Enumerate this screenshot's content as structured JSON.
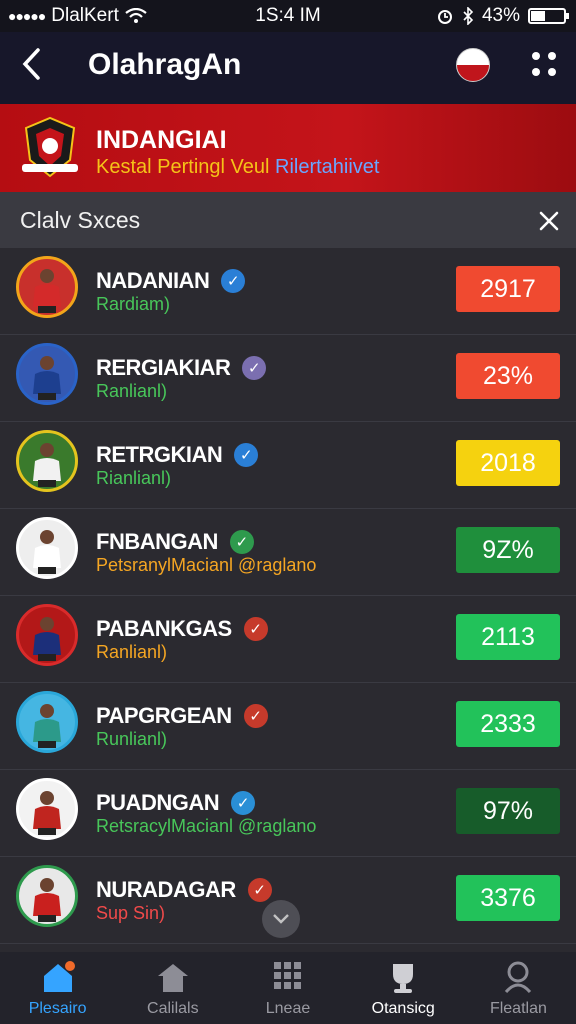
{
  "status": {
    "carrier": "DlalKert",
    "time": "1S:4 IM",
    "battery": "43%",
    "battery_level": 0.43
  },
  "appbar": {
    "title": "OlahragAn",
    "back_icon": "chevron-left-icon",
    "menu_icon": "grid-dots-icon"
  },
  "banner": {
    "title": "INDANGIAI",
    "subtitle_a": "Kestal Pertingl Veul",
    "subtitle_b": "Rilertahiivet"
  },
  "filter": {
    "label": "Clal​v Sxces"
  },
  "rows": [
    {
      "name": "NADANIAN",
      "sub": "Rardiam)",
      "sub_color": "#48c75a",
      "score": "2917",
      "score_color": "#f04a30",
      "badge_color": "#2a7fd6",
      "ring": "#f2a51a",
      "kit": "#d42a2a",
      "bg": "#c8302c"
    },
    {
      "name": "RERGIAKIAR",
      "sub": "Ranlianl)",
      "sub_color": "#48c75a",
      "score": "23%",
      "score_color": "#f04a30",
      "badge_color": "#7b6fb0",
      "ring": "#2a63c8",
      "kit": "#1d3f8f",
      "bg": "#3459b3"
    },
    {
      "name": "RETRGKIAN",
      "sub": "Rianlianl)",
      "sub_color": "#48c75a",
      "score": "2018",
      "score_color": "#f5d20f",
      "badge_color": "#2a7fd6",
      "ring": "#e4c41e",
      "kit": "#f1f1f1",
      "bg": "#3a7a2c"
    },
    {
      "name": "FNBANGAN",
      "sub": "PetsranylMacianl @raglano",
      "sub_color": "#f5a623",
      "score": "9Z%",
      "score_color": "#1f8f3c",
      "badge_color": "#2e9a4d",
      "ring": "#ffffff",
      "kit": "#ffffff",
      "bg": "#eeeeee"
    },
    {
      "name": "PABANKGAS",
      "sub": "Ranlianl)",
      "sub_color": "#f5a623",
      "score": "2113",
      "score_color": "#22c25a",
      "badge_color": "#c63a2b",
      "ring": "#d92b2b",
      "kit": "#1c2f7a",
      "bg": "#b31818"
    },
    {
      "name": "PAPGRGEAN",
      "sub": "Runlianl)",
      "sub_color": "#48c75a",
      "score": "2333",
      "score_color": "#22c25a",
      "badge_color": "#c63a2b",
      "ring": "#2aa7d9",
      "kit": "#2c9a8a",
      "bg": "#45b6e2"
    },
    {
      "name": "PUADNGAN",
      "sub": "RetsracylMacianl @raglano",
      "sub_color": "#48c75a",
      "score": "97%",
      "score_color": "#175c2a",
      "badge_color": "#2a8fd6",
      "ring": "#ffffff",
      "kit": "#c0251f",
      "bg": "#f2f2f2"
    },
    {
      "name": "NURADAGAR",
      "sub": "Sup Sin)",
      "sub_color": "#f04a4a",
      "score": "3376",
      "score_color": "#22c25a",
      "badge_color": "#c63a2b",
      "ring": "#2e9a4d",
      "kit": "#c9201e",
      "bg": "#e8e8e8"
    }
  ],
  "tabs": [
    {
      "label": "Plesairo",
      "icon": "home-icon"
    },
    {
      "label": "Calilals",
      "icon": "house-icon"
    },
    {
      "label": "Lneae",
      "icon": "grid-icon"
    },
    {
      "label": "Otansicg",
      "icon": "trophy-icon"
    },
    {
      "label": "Fleatlan",
      "icon": "profile-icon"
    }
  ]
}
